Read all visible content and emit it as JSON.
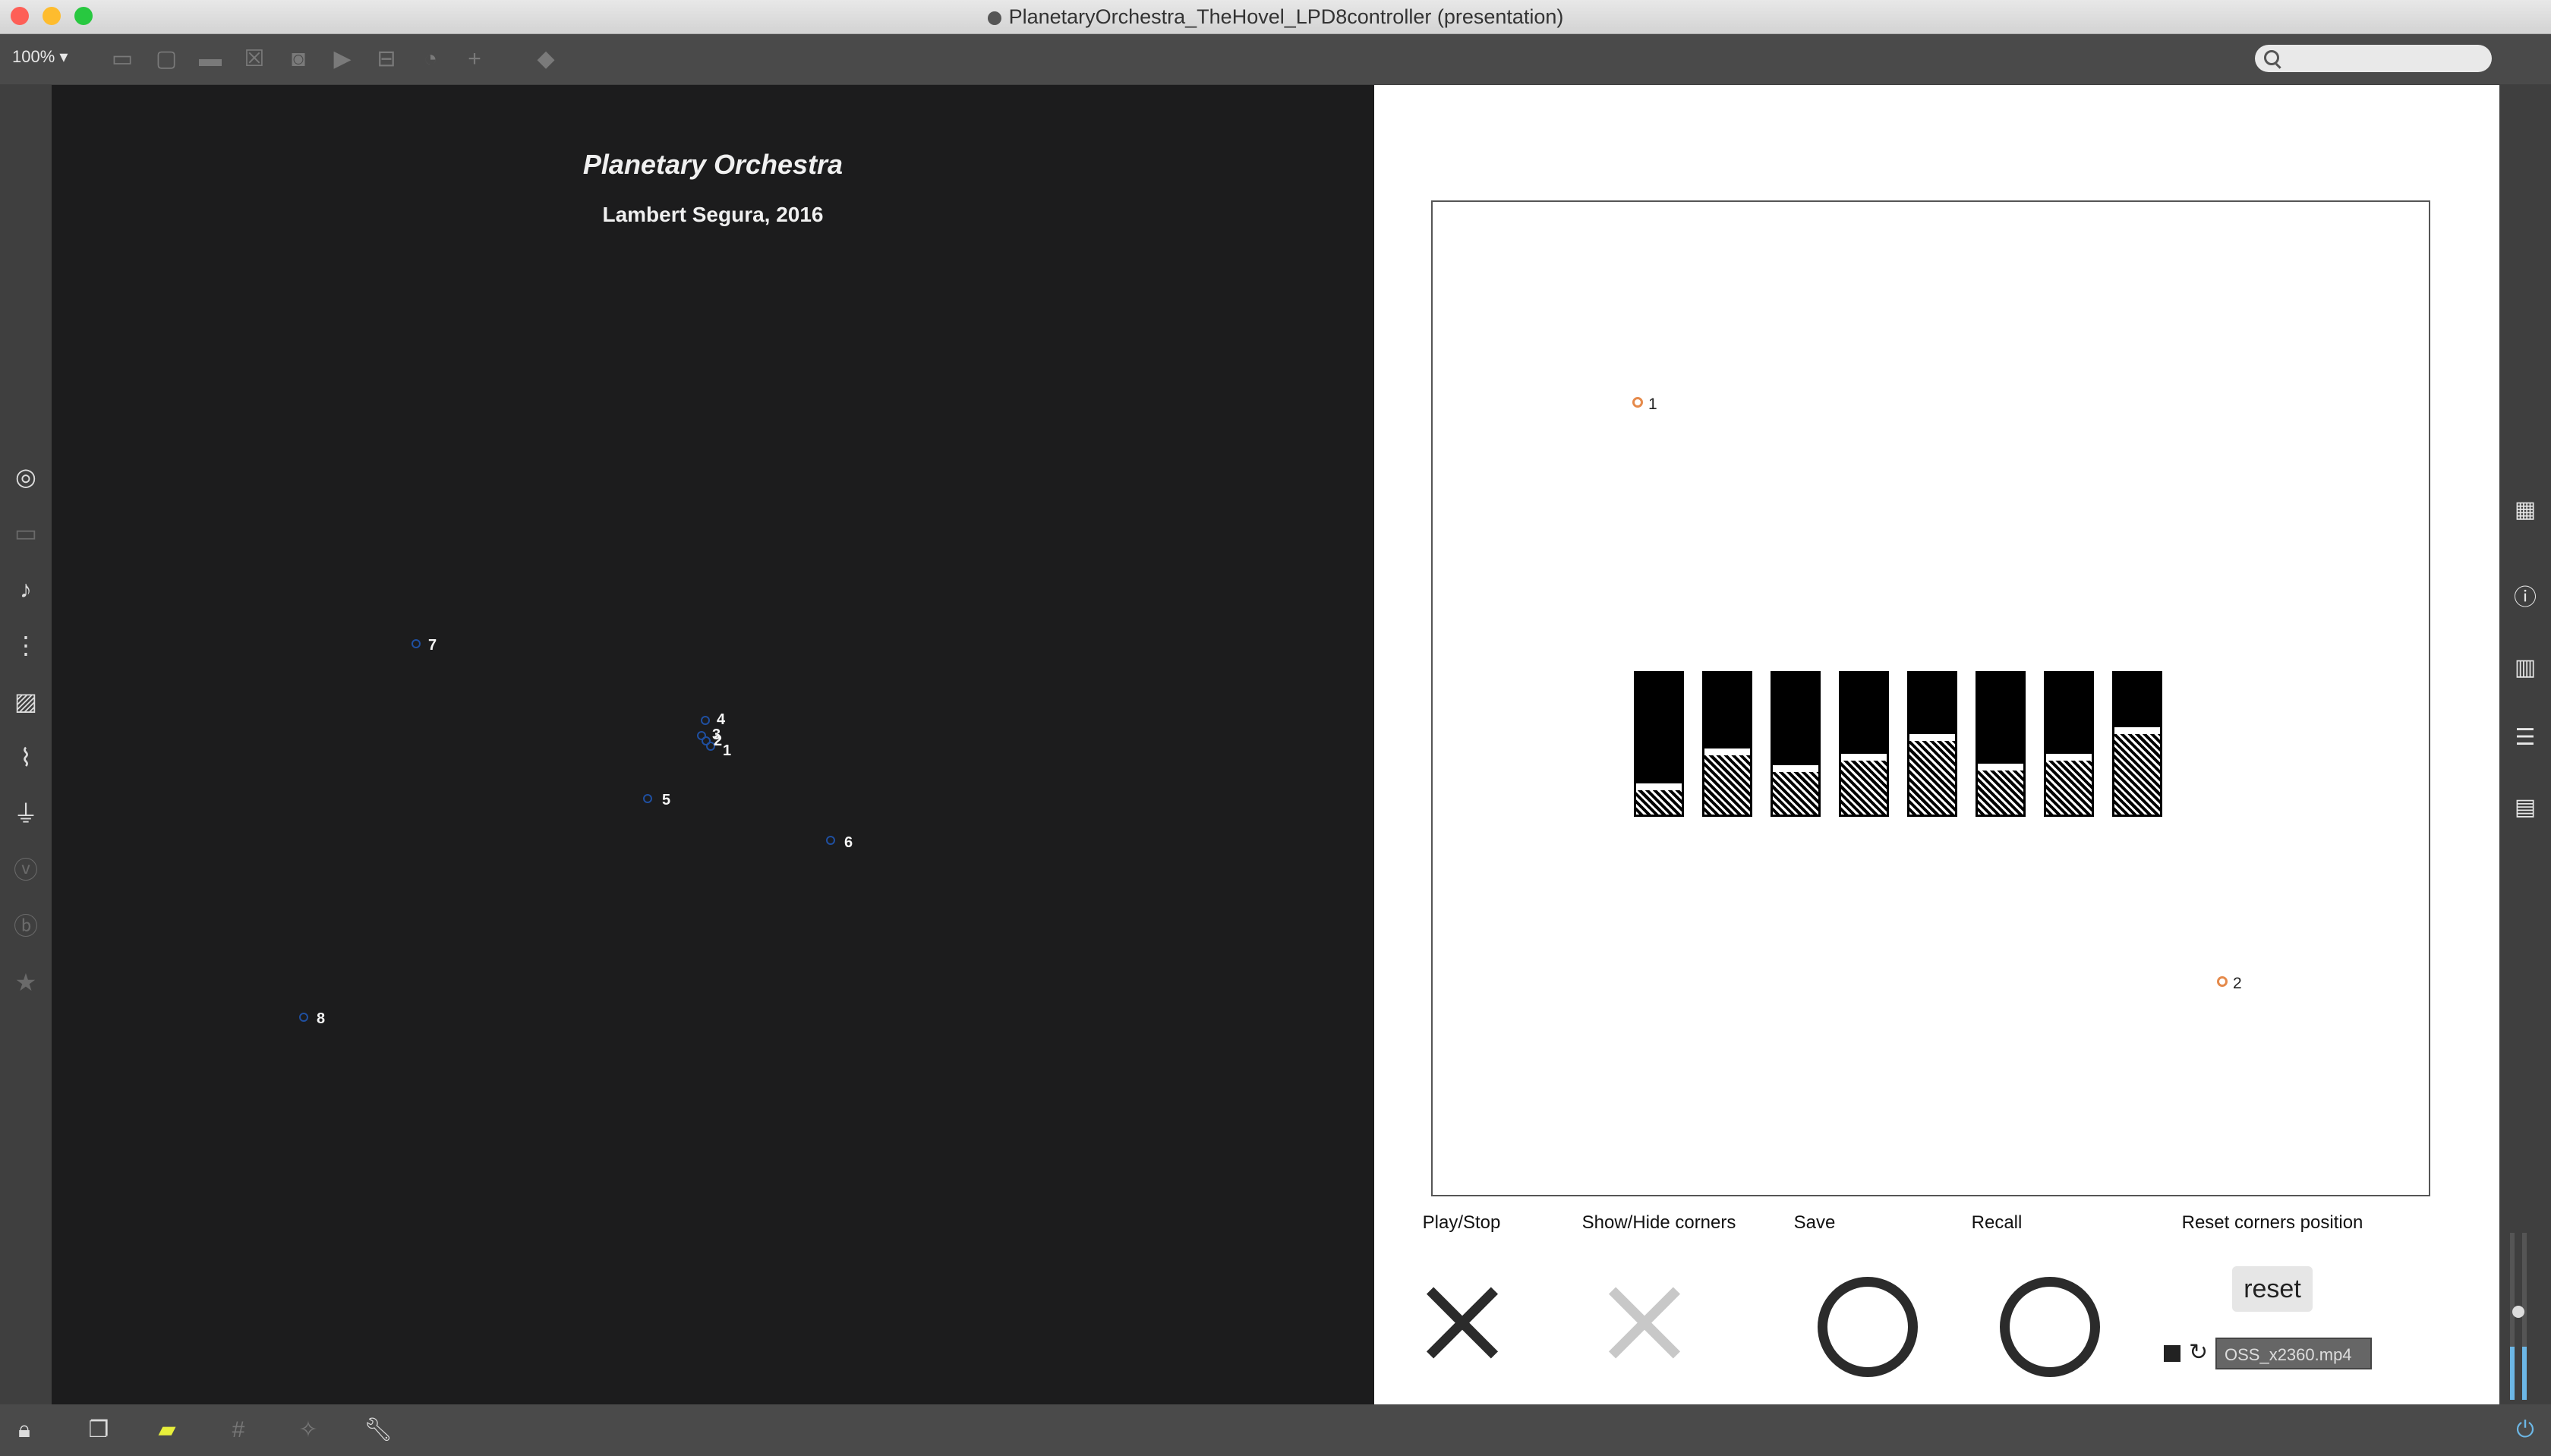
{
  "window": {
    "title": "PlanetaryOrchestra_TheHovel_LPD8controller (presentation)"
  },
  "toolbar": {
    "zoom": "100%"
  },
  "presentation": {
    "title": "Planetary Orchestra",
    "subtitle": "Lambert Segura, 2016",
    "planets": [
      {
        "label": "1"
      },
      {
        "label": "2"
      },
      {
        "label": "3"
      },
      {
        "label": "4"
      },
      {
        "label": "5"
      },
      {
        "label": "6"
      },
      {
        "label": "7"
      },
      {
        "label": "8"
      }
    ]
  },
  "controller": {
    "corners": [
      {
        "label": "1"
      },
      {
        "label": "2"
      }
    ],
    "faders": [
      0.22,
      0.47,
      0.35,
      0.43,
      0.57,
      0.36,
      0.43,
      0.62
    ],
    "controls": {
      "play_stop": "Play/Stop",
      "show_hide": "Show/Hide corners",
      "save": "Save",
      "recall": "Recall",
      "reset_corners": "Reset corners position",
      "reset_button": "reset"
    },
    "player": {
      "file": "OSS_x2360.mp4"
    }
  },
  "colors": {
    "planet": "#1f4fa0",
    "corner": "#e58a4b",
    "background_dark": "#1c1c1d"
  }
}
